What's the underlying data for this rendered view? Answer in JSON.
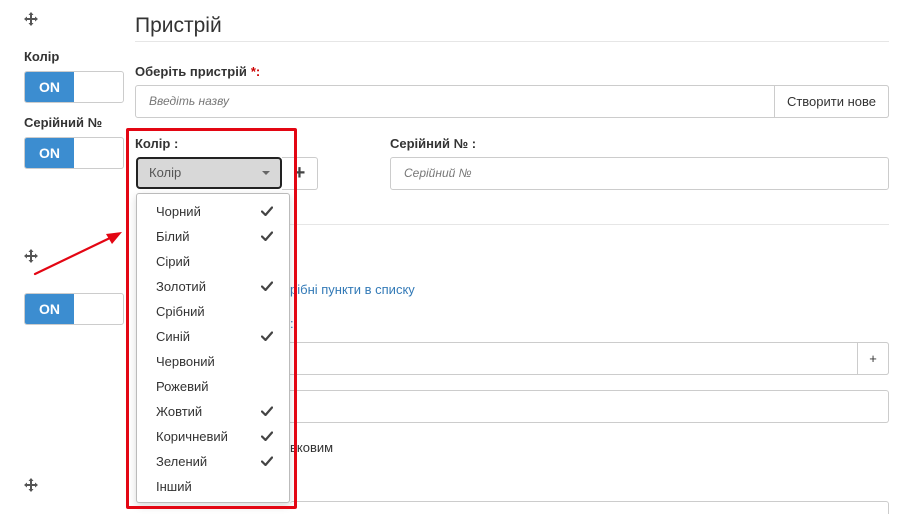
{
  "sidebar": {
    "color_label": "Колір",
    "serial_label": "Серійний №",
    "toggles": [
      "ON",
      "ON",
      "ON"
    ]
  },
  "section": {
    "title": "Пристрій"
  },
  "device_field": {
    "label": "Оберіть пристрій",
    "required_mark": "*:",
    "placeholder": "Введіть назву",
    "create_button": "Створити нове"
  },
  "color_field": {
    "label": "Колір :",
    "selected": "Колір",
    "add_button": "+"
  },
  "serial_field": {
    "label": "Серійний № :",
    "placeholder": "Серійний №"
  },
  "color_options": [
    {
      "label": "Чорний",
      "checked": true
    },
    {
      "label": "Білий",
      "checked": true
    },
    {
      "label": "Сірий",
      "checked": false
    },
    {
      "label": "Золотий",
      "checked": true
    },
    {
      "label": "Срібний",
      "checked": false
    },
    {
      "label": "Синій",
      "checked": true
    },
    {
      "label": "Червоний",
      "checked": false
    },
    {
      "label": "Рожевий",
      "checked": false
    },
    {
      "label": "Жовтий",
      "checked": true
    },
    {
      "label": "Коричневий",
      "checked": true
    },
    {
      "label": "Зелений",
      "checked": true
    },
    {
      "label": "Інший",
      "checked": false
    }
  ],
  "behind": {
    "link_text": "рібні пункти в списку",
    "link_suffix": ":",
    "addon_plus": "+",
    "checkbox_text_frag": "вковим"
  },
  "colors": {
    "accent": "#3c8dd0",
    "highlight": "#e30613",
    "link": "#337ab7"
  }
}
